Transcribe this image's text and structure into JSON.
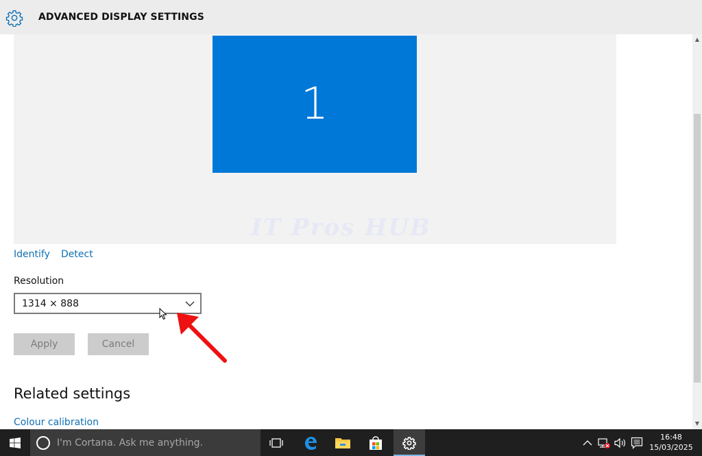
{
  "window": {
    "title": "ADVANCED DISPLAY SETTINGS"
  },
  "preview": {
    "monitor_number": "1",
    "watermark": "IT Pros HUB"
  },
  "links": {
    "identify": "Identify",
    "detect": "Detect"
  },
  "resolution": {
    "label": "Resolution",
    "value": "1314 × 888"
  },
  "buttons": {
    "apply": "Apply",
    "cancel": "Cancel"
  },
  "related": {
    "heading": "Related settings",
    "colour_calibration": "Colour calibration"
  },
  "taskbar": {
    "search_placeholder": "I'm Cortana. Ask me anything.",
    "time": "16:48",
    "date": "15/03/2025",
    "accent": "#0078d7"
  },
  "icons": [
    "gear-icon",
    "chevron-down-icon",
    "windows-logo-icon",
    "cortana-icon",
    "task-view-icon",
    "edge-icon",
    "file-explorer-icon",
    "store-icon",
    "settings-icon",
    "chevron-up-icon",
    "network-icon",
    "volume-icon",
    "action-center-icon"
  ]
}
